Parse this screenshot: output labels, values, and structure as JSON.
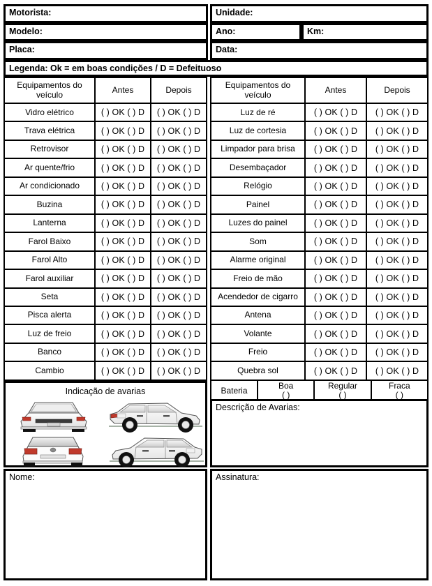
{
  "header": {
    "fields": [
      {
        "label": "Motorista:",
        "value": ""
      },
      {
        "label": "Unidade:",
        "value": ""
      },
      {
        "label": "Modelo:",
        "value": ""
      },
      {
        "label": "Ano:",
        "value": ""
      },
      {
        "label": "Km:",
        "value": ""
      },
      {
        "label": "Placa:",
        "value": ""
      },
      {
        "label": "Data:",
        "value": ""
      }
    ],
    "legend": "Legenda: Ok = em boas condições / D = Defeituoso"
  },
  "table": {
    "columns": [
      "Equipamentos do veículo",
      "Antes",
      "Depois"
    ],
    "mark": "( ) OK ( ) D",
    "left_items": [
      "Vidro elétrico",
      "Trava elétrica",
      "Retrovisor",
      "Ar quente/frio",
      "Ar condicionado",
      "Buzina",
      "Lanterna",
      "Farol Baixo",
      "Farol Alto",
      "Farol auxiliar",
      "Seta",
      "Pisca alerta",
      "Luz de freio",
      "Banco",
      "Cambio"
    ],
    "right_items": [
      "Luz de ré",
      "Luz de cortesia",
      "Limpador para brisa",
      "Desembaçador",
      "Relógio",
      "Painel",
      "Luzes do painel",
      "Som",
      "Alarme original",
      "Freio de mão",
      "Acendedor de cigarro",
      "Antena",
      "Volante",
      "Freio",
      "Quebra sol"
    ]
  },
  "battery": {
    "label": "Bateria",
    "options": [
      {
        "label": "Boa",
        "checkbox": "( )"
      },
      {
        "label": "Regular",
        "checkbox": "( )"
      },
      {
        "label": "Fraca",
        "checkbox": "( )"
      }
    ]
  },
  "damage_panel": {
    "title": "Indicação de avarias",
    "views": [
      "car-front-view",
      "car-rear-view",
      "car-side-right-view",
      "car-side-left-view"
    ]
  },
  "description": {
    "label": "Descrição de Avarias:",
    "value": ""
  },
  "name_box": {
    "label": "Nome:",
    "value": ""
  },
  "signature_box": {
    "label": "Assinatura:",
    "value": ""
  },
  "colors": {
    "border": "#000000",
    "background": "#ffffff",
    "taillight": "#c0392b"
  }
}
